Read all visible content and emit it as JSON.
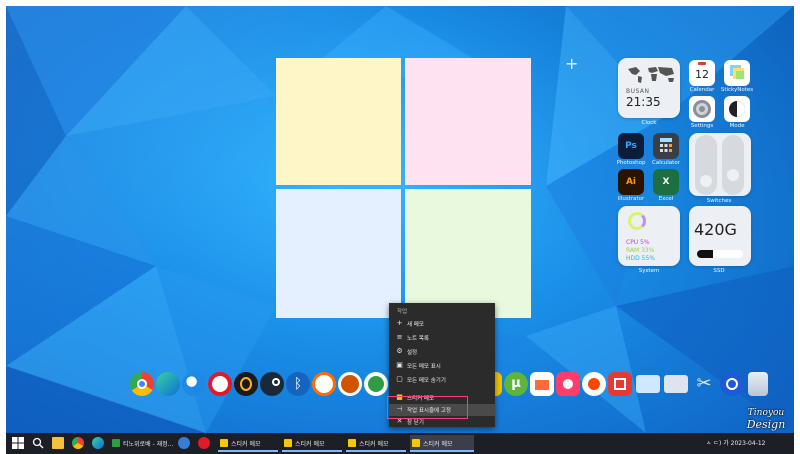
{
  "colors": {
    "sticky_yellow": "#fff6c8",
    "sticky_pink": "#ffe3f1",
    "sticky_blue": "#e4efff",
    "sticky_green": "#e9f9dd",
    "menu_bg": "#2b2b2b",
    "highlight_border": "#ff3d7a"
  },
  "widgets": {
    "clock": {
      "city": "BUSAN",
      "time": "21:35",
      "label": "Clock"
    },
    "calendar": {
      "day": "12",
      "label": "Calendar"
    },
    "stickynotes": {
      "label": "StickyNotes"
    },
    "settings": {
      "label": "Settings"
    },
    "mode": {
      "label": "Mode"
    },
    "photoshop": {
      "text": "Ps",
      "label": "Photoshop"
    },
    "calculator": {
      "label": "Calculator"
    },
    "switches": {
      "label": "Switches"
    },
    "illustrator": {
      "text": "Ai",
      "label": "Illustrator"
    },
    "excel": {
      "text": "X",
      "label": "Excel"
    },
    "system": {
      "cpu": "CPU 5%",
      "ram": "RAM 33%",
      "hdd": "HDD 55%",
      "label": "System"
    },
    "ssd": {
      "value": "420G",
      "label": "SSD",
      "used_fraction": 0.34
    }
  },
  "context_menu": {
    "header": "작업",
    "items": [
      {
        "icon": "plus-icon",
        "glyph": "+",
        "label": "새 메모"
      },
      {
        "icon": "list-icon",
        "glyph": "≡",
        "label": "노트 목록"
      },
      {
        "icon": "gear-icon",
        "glyph": "⚙",
        "label": "설정"
      },
      {
        "icon": "show-icon",
        "glyph": "▣",
        "label": "모든 메모 표시"
      },
      {
        "icon": "hide-icon",
        "glyph": "▢",
        "label": "모든 메모 숨기기"
      },
      {
        "icon": "sticky-icon",
        "glyph": "■",
        "label": "스티커 메모"
      },
      {
        "icon": "pin-icon",
        "glyph": "⊣",
        "label": "작업 표시줄에 고정"
      },
      {
        "icon": "close-icon",
        "glyph": "✕",
        "label": "창 닫기"
      }
    ]
  },
  "taskbar": {
    "items": [
      {
        "label": "티노위로배 - 재정..."
      },
      {
        "label": "스티커 메모"
      },
      {
        "label": "스티커 메모"
      },
      {
        "label": "스티커 메모"
      },
      {
        "label": "스티커 메모"
      }
    ],
    "tray": "ㅅ ㄷ) 가 2023-04-12"
  },
  "watermark": {
    "line1": "Tinoyou",
    "line2": "Design"
  }
}
